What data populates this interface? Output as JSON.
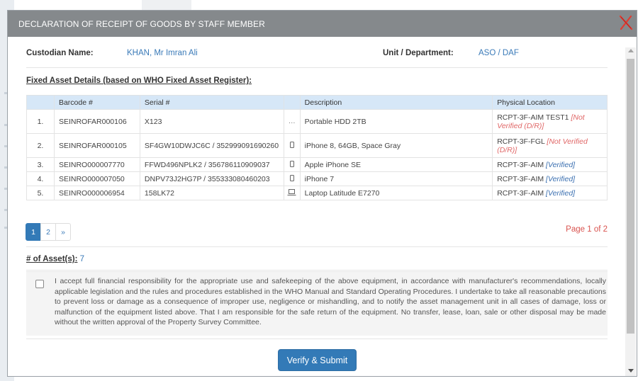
{
  "modal": {
    "title": "DECLARATION OF RECEIPT OF GOODS BY STAFF MEMBER",
    "close_color": "#e03c31"
  },
  "custodian": {
    "label": "Custodian Name:",
    "value": "KHAN, Mr Imran Ali",
    "unit_label": "Unit / Department:",
    "unit_value": "ASO / DAF"
  },
  "section_title": "Fixed Asset Details (based on WHO Fixed Asset Register):",
  "table": {
    "headers": [
      "",
      "Barcode #",
      "Serial #",
      "",
      "Description",
      "Physical Location"
    ],
    "rows": [
      {
        "num": "1.",
        "barcode": "SEINROFAR000106",
        "serial": "X123",
        "icon": "ellipsis-icon",
        "icon_glyph": "…",
        "description": "Portable HDD 2TB",
        "location": "RCPT-3F-AIM TEST1",
        "status": "[Not Verified (D/R)]",
        "status_color": "red"
      },
      {
        "num": "2.",
        "barcode": "SEINROFAR000105",
        "serial": "SF4GW10DWJC6C / 352999091690260",
        "icon": "mobile-icon",
        "icon_glyph": "▯",
        "description": "iPhone 8, 64GB, Space Gray",
        "location": "RCPT-3F-FGL",
        "status": "[Not Verified (D/R)]",
        "status_color": "red"
      },
      {
        "num": "3.",
        "barcode": "SEINRO000007770",
        "serial": "FFWD496NPLK2 / 356786110909037",
        "icon": "mobile-icon",
        "icon_glyph": "▯",
        "description": "Apple iPhone SE",
        "location": "RCPT-3F-AIM",
        "status": "[Verified]",
        "status_color": "blue"
      },
      {
        "num": "4.",
        "barcode": "SEINRO000007050",
        "serial": "DNPV73J2HG7P / 355333080460203",
        "icon": "mobile-icon",
        "icon_glyph": "▯",
        "description": "iPhone 7",
        "location": "RCPT-3F-AIM",
        "status": "[Verified]",
        "status_color": "blue"
      },
      {
        "num": "5.",
        "barcode": "SEINRO000006954",
        "serial": "158LK72",
        "icon": "laptop-icon",
        "icon_glyph": "laptop",
        "description": "Laptop Latitude E7270",
        "location": "RCPT-3F-AIM",
        "status": "[Verified]",
        "status_color": "blue"
      }
    ]
  },
  "pagination": {
    "pages": [
      "1",
      "2",
      "»"
    ],
    "active": "1",
    "page_of": "Page 1 of 2"
  },
  "asset_count": {
    "label": "# of Asset(s):",
    "value": "7"
  },
  "declaration": {
    "checked": false,
    "text": "I accept full financial responsibility for the appropriate use and safekeeping of the above equipment, in accordance with manufacturer's recommendations, locally applicable legislation and the rules and procedures established in the WHO Manual and Standard Operating Procedures. I undertake to take all reasonable precautions to prevent loss or damage as a consequence of improper use, negligence or mishandling, and to notify the asset management unit in all cases of damage, loss or malfunction of the equipment listed above. That I am responsible for the safe return of the equipment. No transfer, lease, loan, sale or other disposal may be made without the written approval of the Property Survey Committee."
  },
  "submit": {
    "label": "Verify & Submit",
    "color": "#337ab7"
  }
}
